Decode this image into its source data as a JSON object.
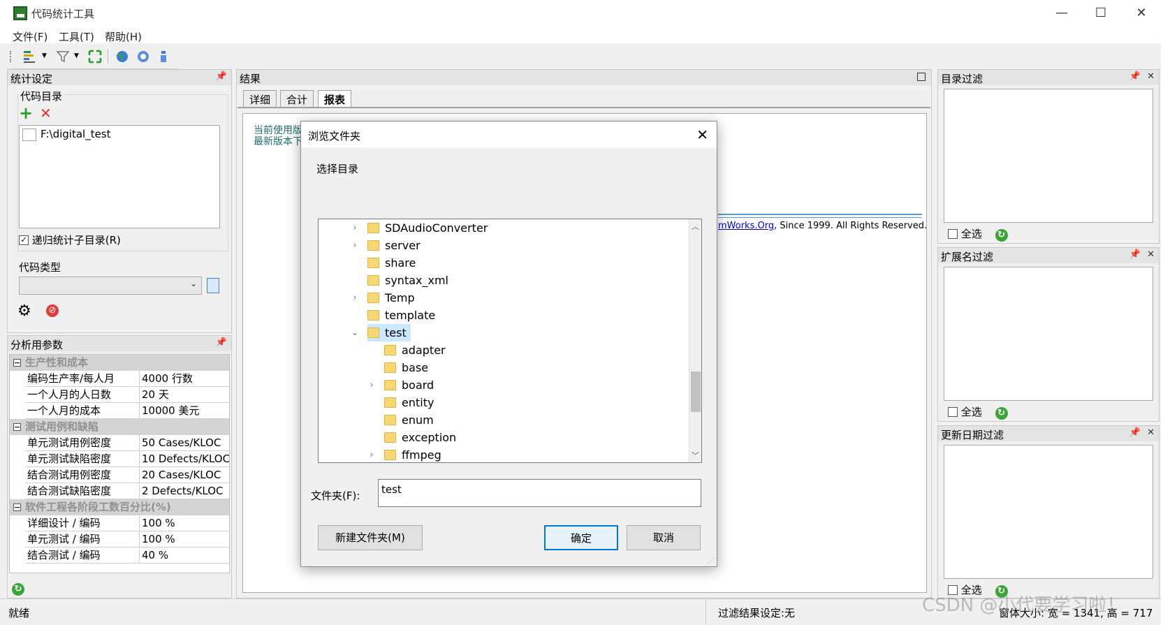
{
  "window": {
    "title": "代码统计工具",
    "minimize": "—",
    "maximize": "☐",
    "close": "✕"
  },
  "menu": [
    {
      "label": "文件(F)"
    },
    {
      "label": "工具(T)"
    },
    {
      "label": "帮助(H)"
    }
  ],
  "stats_panel": {
    "title": "统计设定",
    "code_dir_label": "代码目录",
    "dirs": [
      "F:\\digital_test"
    ],
    "recursive_label": "递归统计子目录(R)",
    "code_type_label": "代码类型",
    "code_type_value": ""
  },
  "analysis_panel": {
    "title": "分析用参数",
    "groups": [
      {
        "name": "生产性和成本",
        "rows": [
          {
            "label": "编码生产率/每人月",
            "value": "4000 行数"
          },
          {
            "label": "一个人月的人日数",
            "value": "20 天"
          },
          {
            "label": "一个人月的成本",
            "value": "10000 美元"
          }
        ]
      },
      {
        "name": "测试用例和缺陷",
        "rows": [
          {
            "label": "单元测试用例密度",
            "value": "50 Cases/KLOC"
          },
          {
            "label": "单元测试缺陷密度",
            "value": "10 Defects/KLOC"
          },
          {
            "label": "结合测试用例密度",
            "value": "20 Cases/KLOC"
          },
          {
            "label": "结合测试缺陷密度",
            "value": "2 Defects/KLOC"
          }
        ]
      },
      {
        "name": "软件工程各阶段工数百分比(%)",
        "rows": [
          {
            "label": "详细设计 / 编码",
            "value": "100 %"
          },
          {
            "label": "单元测试 / 编码",
            "value": "100 %"
          },
          {
            "label": "结合测试 / 编码",
            "value": "40 %"
          }
        ]
      }
    ]
  },
  "results_panel": {
    "title": "结果",
    "tabs": [
      {
        "label": "详细"
      },
      {
        "label": "合计"
      },
      {
        "label": "报表"
      }
    ],
    "active_tab": 2,
    "report_line1": "当前使用版",
    "report_line2": "最新版本下",
    "copyright_link": "mWorks.Org",
    "copyright_text": ", Since 1999. All Rights Reserved."
  },
  "right_panels": [
    {
      "title": "目录过滤",
      "select_all": "全选"
    },
    {
      "title": "扩展名过滤",
      "select_all": "全选"
    },
    {
      "title": "更新日期过滤",
      "select_all": "全选"
    }
  ],
  "dialog": {
    "title": "浏览文件夹",
    "prompt": "选择目录",
    "tree": [
      {
        "name": "SDAudioConverter",
        "level": 0,
        "expandable": true,
        "expanded": false
      },
      {
        "name": "server",
        "level": 0,
        "expandable": true,
        "expanded": false
      },
      {
        "name": "share",
        "level": 0,
        "expandable": false,
        "expanded": false
      },
      {
        "name": "syntax_xml",
        "level": 0,
        "expandable": false,
        "expanded": false
      },
      {
        "name": "Temp",
        "level": 0,
        "expandable": true,
        "expanded": false
      },
      {
        "name": "template",
        "level": 0,
        "expandable": false,
        "expanded": false
      },
      {
        "name": "test",
        "level": 0,
        "expandable": true,
        "expanded": true,
        "selected": true
      },
      {
        "name": "adapter",
        "level": 1,
        "expandable": false,
        "expanded": false
      },
      {
        "name": "base",
        "level": 1,
        "expandable": false,
        "expanded": false
      },
      {
        "name": "board",
        "level": 1,
        "expandable": true,
        "expanded": false
      },
      {
        "name": "entity",
        "level": 1,
        "expandable": false,
        "expanded": false
      },
      {
        "name": "enum",
        "level": 1,
        "expandable": false,
        "expanded": false
      },
      {
        "name": "exception",
        "level": 1,
        "expandable": false,
        "expanded": false
      },
      {
        "name": "ffmpeg",
        "level": 1,
        "expandable": true,
        "expanded": false
      }
    ],
    "folder_label": "文件夹(F):",
    "folder_value": "test",
    "new_folder_button": "新建文件夹(M)",
    "ok_button": "确定",
    "cancel_button": "取消"
  },
  "status": {
    "left": "就绪",
    "filter": "过滤结果设定:无",
    "size": "窗体大小: 宽 = 1341, 高 = 717"
  },
  "watermark": "CSDN @小代要学习啦！",
  "colors": {
    "accent": "#0078d7",
    "link": "#0000cc",
    "report_text": "#1f6e6e"
  }
}
